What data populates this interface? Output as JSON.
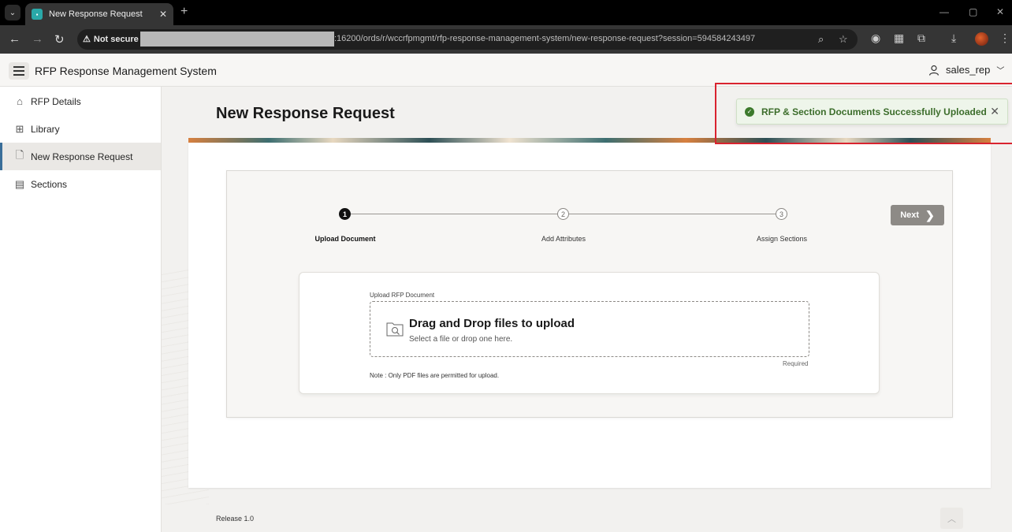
{
  "browser": {
    "tab_title": "New Response Request",
    "security_label": "Not secure",
    "url_visible": ":16200/ords/r/wccrfpmgmt/rfp-response-management-system/new-response-request?session=594584243497"
  },
  "app": {
    "title": "RFP Response Management System",
    "user": "sales_rep"
  },
  "sidebar": {
    "items": [
      {
        "label": "RFP Details",
        "icon": "home-icon"
      },
      {
        "label": "Library",
        "icon": "table-icon"
      },
      {
        "label": "New Response Request",
        "icon": "new-doc-icon",
        "active": true
      },
      {
        "label": "Sections",
        "icon": "grid-icon"
      }
    ]
  },
  "page": {
    "title": "New Response Request"
  },
  "wizard": {
    "steps": [
      {
        "number": "1",
        "label": "Upload Document",
        "state": "current"
      },
      {
        "number": "2",
        "label": "Add Attributes",
        "state": "todo"
      },
      {
        "number": "3",
        "label": "Assign Sections",
        "state": "todo"
      }
    ],
    "next_label": "Next"
  },
  "upload": {
    "field_label": "Upload RFP Document",
    "title": "Drag and Drop files to upload",
    "subtitle": "Select a file or drop one here.",
    "required": "Required",
    "note": "Note : Only PDF files are permitted for upload."
  },
  "footer": {
    "release": "Release 1.0"
  },
  "toast": {
    "message": "RFP & Section Documents Successfully Uploaded"
  },
  "colors": {
    "success": "#3c7a2c",
    "highlight": "#d9232f",
    "active_nav_accent": "#3a6e99"
  }
}
